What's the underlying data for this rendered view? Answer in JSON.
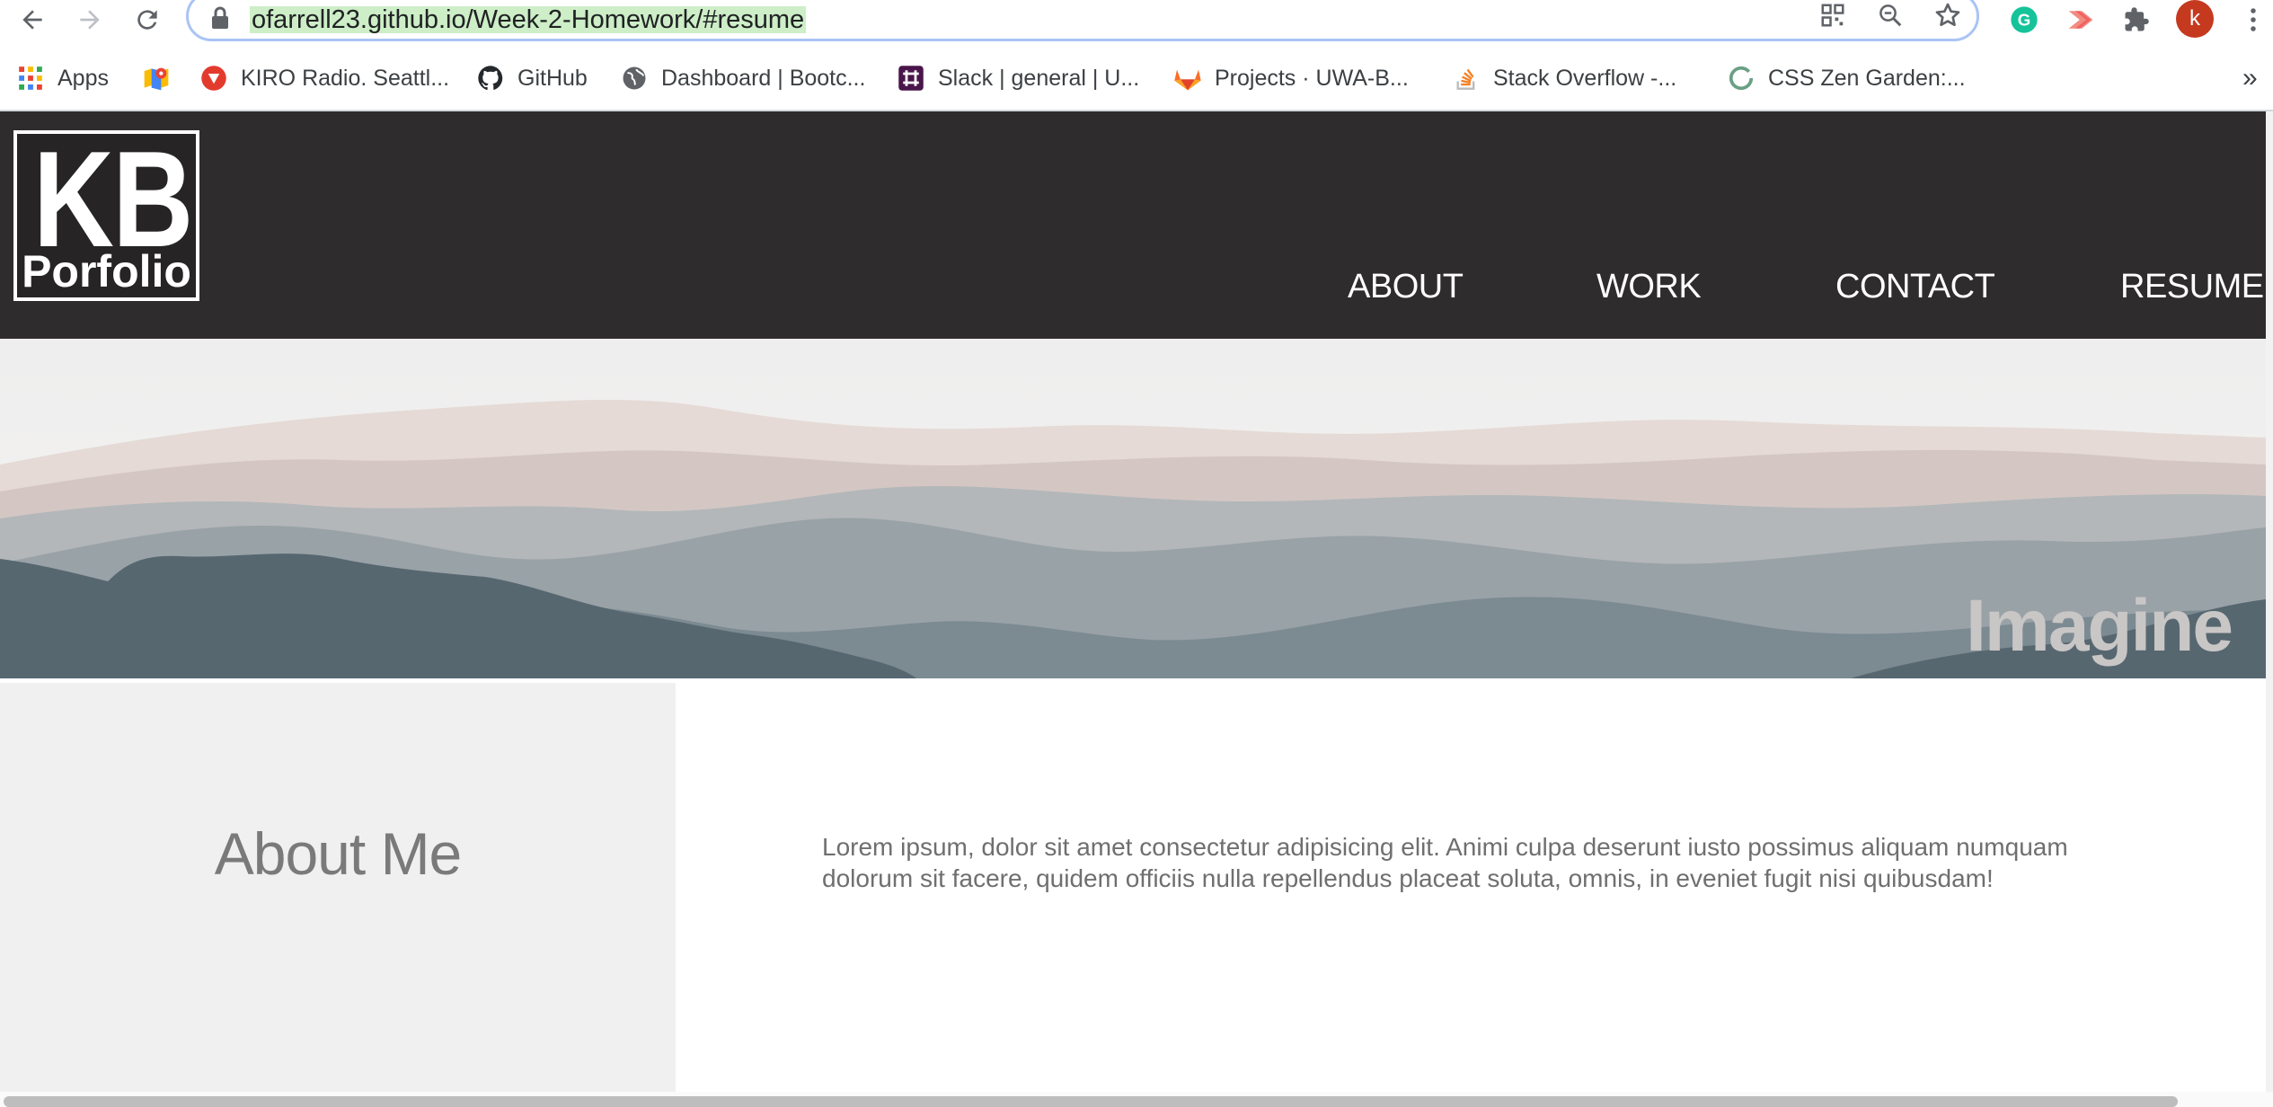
{
  "browser": {
    "url": "ofarrell23.github.io/Week-2-Homework/#resume",
    "profile_initial": "k",
    "bookmarks": [
      {
        "label": "Apps",
        "icon": "apps-grid-icon"
      },
      {
        "label": "",
        "icon": "google-maps-icon"
      },
      {
        "label": "KIRO Radio. Seattl...",
        "icon": "kiro-radio-icon"
      },
      {
        "label": "GitHub",
        "icon": "github-icon"
      },
      {
        "label": "Dashboard | Bootc...",
        "icon": "globe-icon"
      },
      {
        "label": "Slack | general | U...",
        "icon": "slack-icon"
      },
      {
        "label": "Projects · UWA-B...",
        "icon": "gitlab-icon"
      },
      {
        "label": "Stack Overflow -...",
        "icon": "stackoverflow-icon"
      },
      {
        "label": "CSS Zen Garden:...",
        "icon": "zen-garden-icon"
      }
    ],
    "overflow_label": "»"
  },
  "header": {
    "logo_top": "KB",
    "logo_bottom": "Porfolio",
    "nav": [
      "ABOUT",
      "WORK",
      "CONTACT",
      "RESUME"
    ]
  },
  "hero": {
    "tagline": "Imagine"
  },
  "about": {
    "title": "About Me",
    "body": "Lorem ipsum, dolor sit amet consectetur adipisicing elit. Animi culpa deserunt iusto possimus aliquam numquam dolorum sit facere, quidem officiis nulla repellendus placeat soluta, omnis, in eveniet fugit nisi quibusdam!"
  },
  "colors": {
    "header_bg": "#2e2c2d",
    "about_panel_bg": "#f0f0f0",
    "url_highlight": "#cdeec7",
    "profile_avatar": "#c5391e"
  }
}
